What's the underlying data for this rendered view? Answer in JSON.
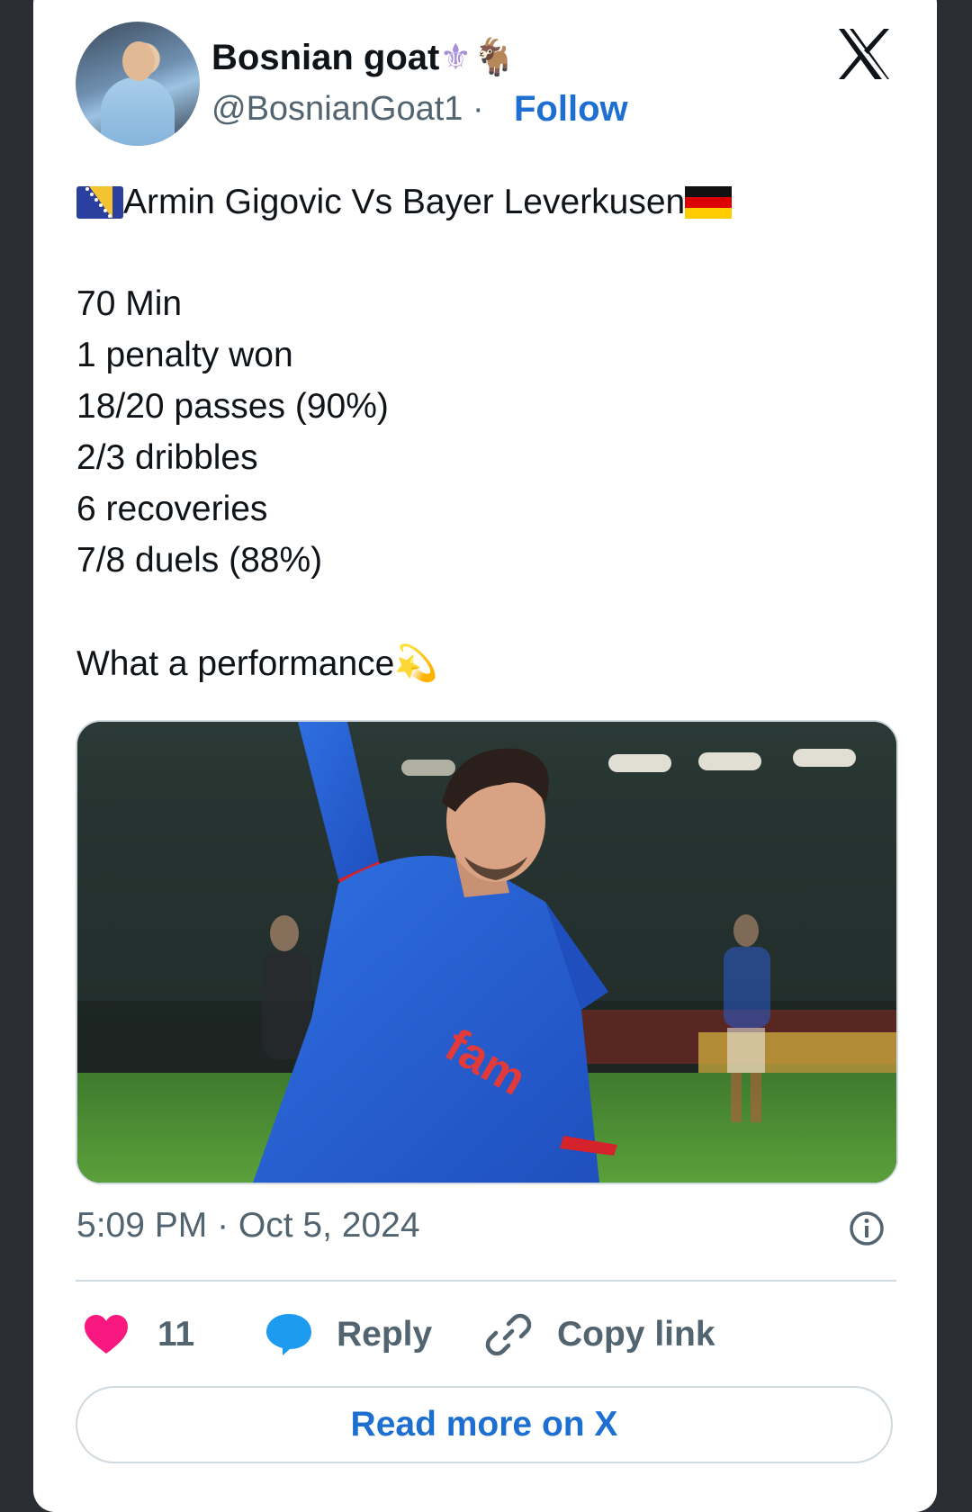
{
  "author": {
    "display_name": "Bosnian goat",
    "name_emojis": "⚜🐐",
    "handle": "@BosnianGoat1",
    "separator": "·",
    "follow_label": "Follow"
  },
  "tweet": {
    "headline": "Armin Gigovic Vs Bayer Leverkusen",
    "stats": [
      "70 Min",
      "1 penalty won",
      "18/20 passes (90%)",
      "2/3 dribbles",
      "6 recoveries",
      "7/8 duels (88%)"
    ],
    "closing": "What a performance",
    "closing_emoji": "💫"
  },
  "meta": {
    "timestamp": "5:09 PM · Oct 5, 2024"
  },
  "actions": {
    "like_count": "11",
    "reply_label": "Reply",
    "copy_link_label": "Copy link",
    "read_more_label": "Read more on X"
  },
  "icons": {
    "x_logo": "x-logo-icon",
    "info": "info-icon",
    "heart": "heart-icon",
    "reply": "speech-bubble-icon",
    "copy_link": "link-icon"
  },
  "colors": {
    "accent": "#1d6fd1",
    "like": "#f91880",
    "reply": "#1d9bf0",
    "text": "#0f1419",
    "muted": "#536471"
  }
}
